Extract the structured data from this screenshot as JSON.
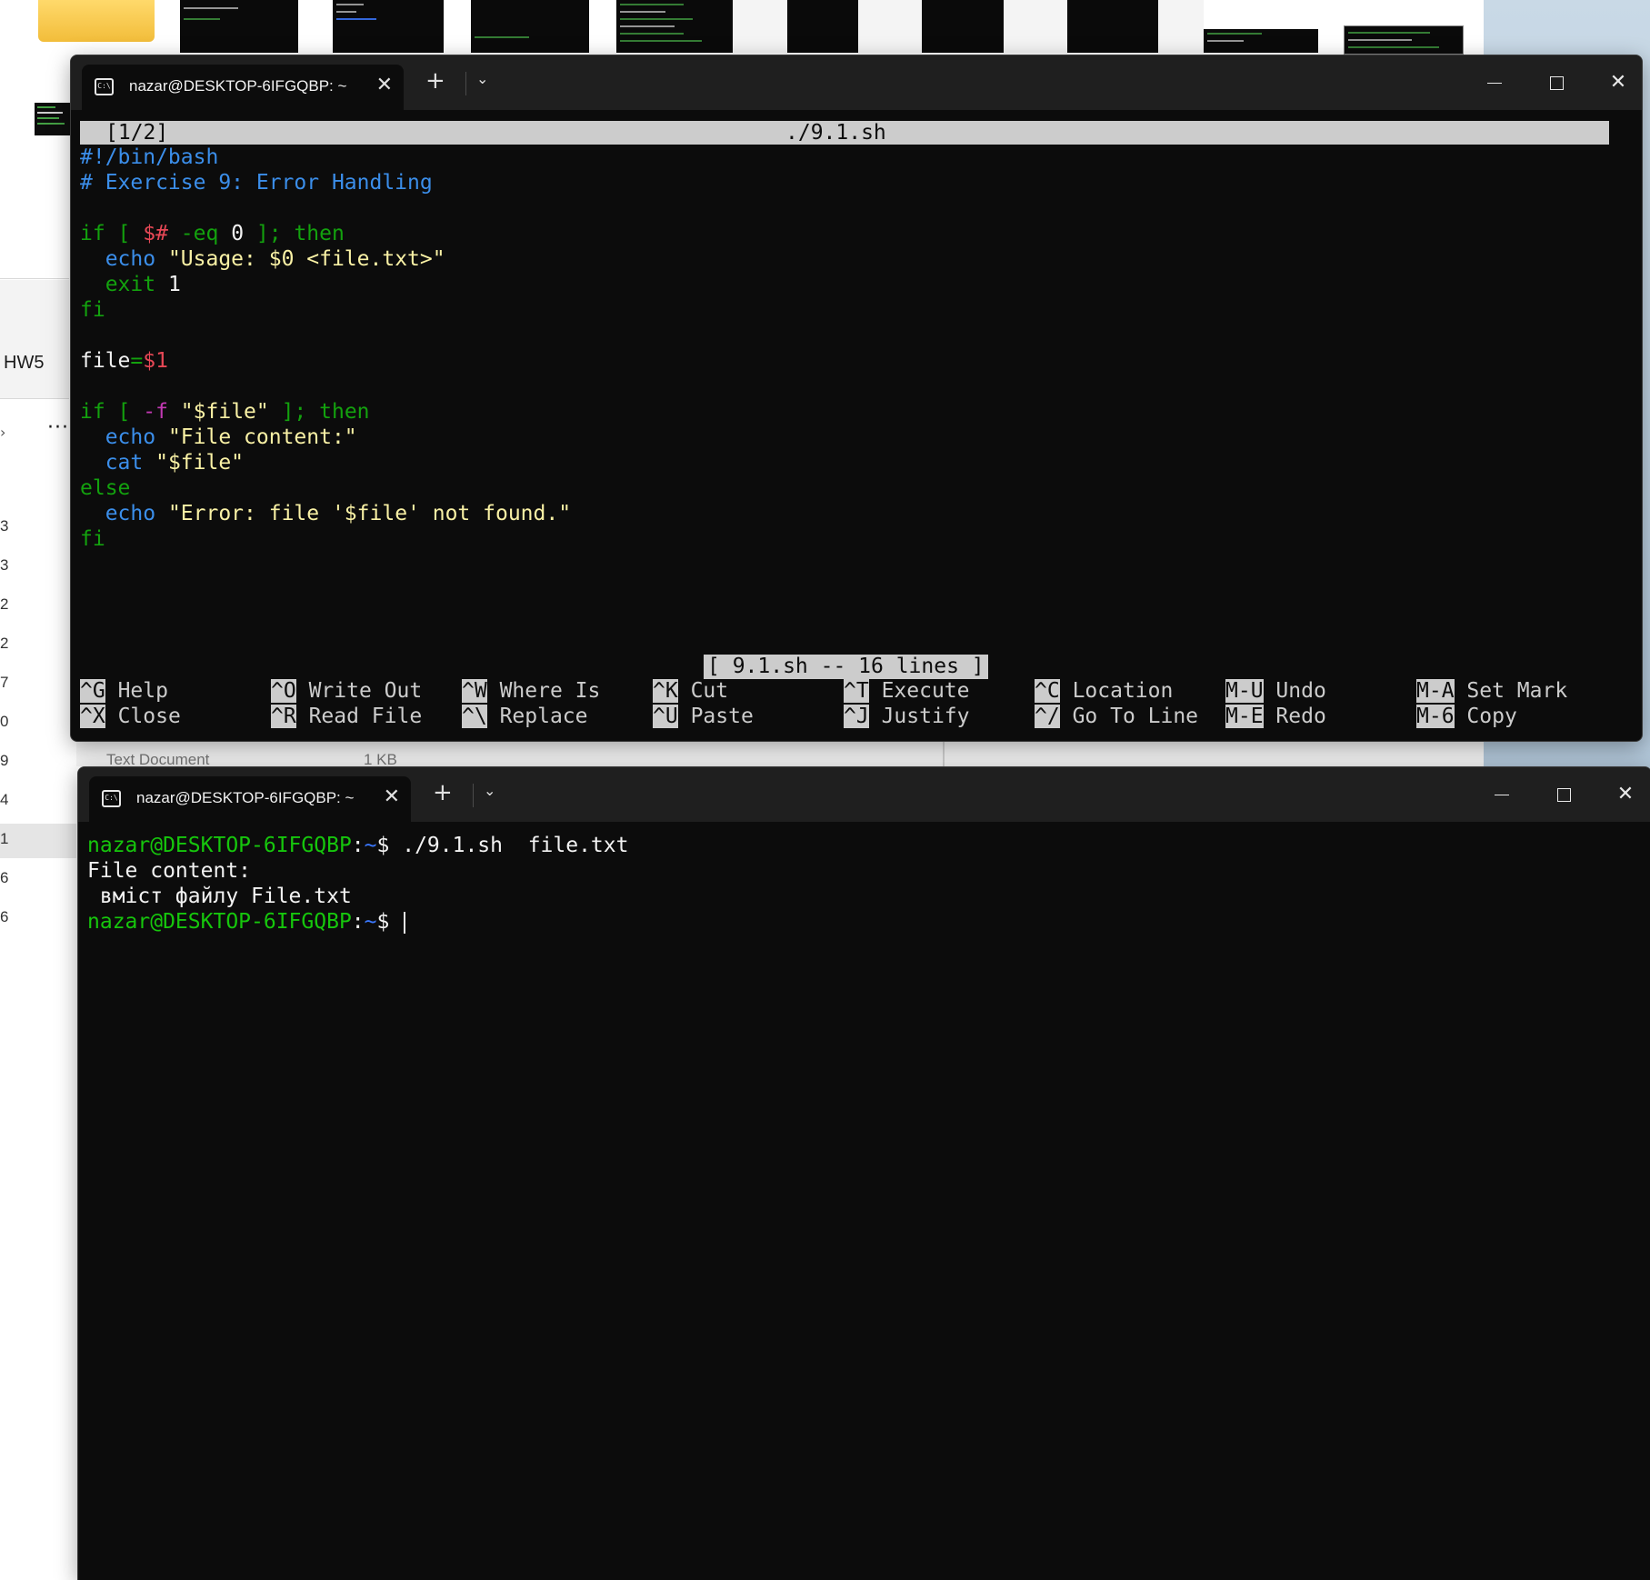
{
  "background": {
    "explorer_label": "HW5",
    "more_button": "···",
    "row_numbers": [
      "3",
      "3",
      "2",
      "2",
      "7",
      "0",
      "9",
      "4",
      "1",
      "6",
      "6"
    ],
    "peek_type": "Text Document",
    "peek_size": "1 KB"
  },
  "editor_window": {
    "tab_title": "nazar@DESKTOP-6IFGQBP: ~",
    "tab_icon": "C:\\",
    "close_tab": "✕",
    "new_tab": "+",
    "dropdown": "⌄",
    "close_window": "✕",
    "nano": {
      "buffer_index": "[1/2]",
      "file_name": "./9.1.sh",
      "status_message": "[ 9.1.sh -- 16 lines ]",
      "code": {
        "l1": "#!/bin/bash",
        "l2": "# Exercise 9: Error Handling",
        "l4_if": "if",
        "l4_br": " [ ",
        "l4_var": "$#",
        "l4_op": " -eq ",
        "l4_num": "0",
        "l4_end": " ]; then",
        "l5_echo": "  echo",
        "l5_str": " \"Usage: $0 <file.txt>\"",
        "l6_exit": "  exit",
        "l6_num": " 1",
        "l7": "fi",
        "l9_name": "file",
        "l9_eq": "=",
        "l9_val": "$1",
        "l11_if": "if",
        "l11_br": " [ ",
        "l11_flag": "-f",
        "l11_str": " \"$file\"",
        "l11_end": " ]; then",
        "l12_echo": "  echo",
        "l12_str": " \"File content:\"",
        "l13_cat": "  cat",
        "l13_str": " \"$file\"",
        "l14": "else",
        "l15_echo": "  echo",
        "l15_str": " \"Error: file '$file' not found.\"",
        "l16": "fi"
      },
      "shortcuts": [
        {
          "key": "^G",
          "label": "Help"
        },
        {
          "key": "^X",
          "label": "Close"
        },
        {
          "key": "^O",
          "label": "Write Out"
        },
        {
          "key": "^R",
          "label": "Read File"
        },
        {
          "key": "^W",
          "label": "Where Is"
        },
        {
          "key": "^\\",
          "label": "Replace"
        },
        {
          "key": "^K",
          "label": "Cut"
        },
        {
          "key": "^U",
          "label": "Paste"
        },
        {
          "key": "^T",
          "label": "Execute"
        },
        {
          "key": "^J",
          "label": "Justify"
        },
        {
          "key": "^C",
          "label": "Location"
        },
        {
          "key": "^/",
          "label": "Go To Line"
        },
        {
          "key": "M-U",
          "label": "Undo"
        },
        {
          "key": "M-E",
          "label": "Redo"
        },
        {
          "key": "M-A",
          "label": "Set Mark"
        },
        {
          "key": "M-6",
          "label": "Copy"
        }
      ]
    }
  },
  "shell_window": {
    "tab_title": "nazar@DESKTOP-6IFGQBP: ~",
    "tab_icon": "C:\\",
    "close_tab": "✕",
    "new_tab": "+",
    "dropdown": "⌄",
    "close_window": "✕",
    "prompt_user": "nazar@DESKTOP-6IFGQBP",
    "prompt_sep": ":",
    "prompt_path": "~",
    "prompt_dollar": "$",
    "command": " ./9.1.sh  file.txt",
    "output_1": "File content:",
    "output_2": " вміст файлу File.txt"
  }
}
